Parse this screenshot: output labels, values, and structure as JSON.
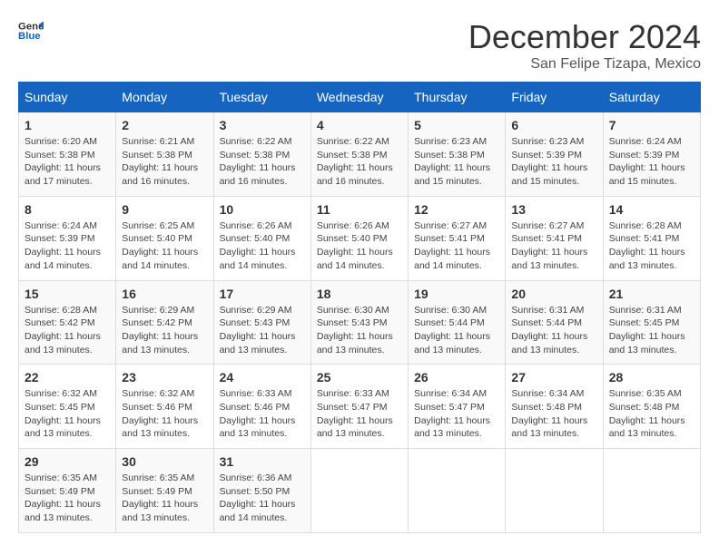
{
  "logo": {
    "general": "General",
    "blue": "Blue"
  },
  "header": {
    "title": "December 2024",
    "location": "San Felipe Tizapa, Mexico"
  },
  "weekdays": [
    "Sunday",
    "Monday",
    "Tuesday",
    "Wednesday",
    "Thursday",
    "Friday",
    "Saturday"
  ],
  "weeks": [
    [
      {
        "day": "1",
        "sunrise": "Sunrise: 6:20 AM",
        "sunset": "Sunset: 5:38 PM",
        "daylight": "Daylight: 11 hours and 17 minutes."
      },
      {
        "day": "2",
        "sunrise": "Sunrise: 6:21 AM",
        "sunset": "Sunset: 5:38 PM",
        "daylight": "Daylight: 11 hours and 16 minutes."
      },
      {
        "day": "3",
        "sunrise": "Sunrise: 6:22 AM",
        "sunset": "Sunset: 5:38 PM",
        "daylight": "Daylight: 11 hours and 16 minutes."
      },
      {
        "day": "4",
        "sunrise": "Sunrise: 6:22 AM",
        "sunset": "Sunset: 5:38 PM",
        "daylight": "Daylight: 11 hours and 16 minutes."
      },
      {
        "day": "5",
        "sunrise": "Sunrise: 6:23 AM",
        "sunset": "Sunset: 5:38 PM",
        "daylight": "Daylight: 11 hours and 15 minutes."
      },
      {
        "day": "6",
        "sunrise": "Sunrise: 6:23 AM",
        "sunset": "Sunset: 5:39 PM",
        "daylight": "Daylight: 11 hours and 15 minutes."
      },
      {
        "day": "7",
        "sunrise": "Sunrise: 6:24 AM",
        "sunset": "Sunset: 5:39 PM",
        "daylight": "Daylight: 11 hours and 15 minutes."
      }
    ],
    [
      {
        "day": "8",
        "sunrise": "Sunrise: 6:24 AM",
        "sunset": "Sunset: 5:39 PM",
        "daylight": "Daylight: 11 hours and 14 minutes."
      },
      {
        "day": "9",
        "sunrise": "Sunrise: 6:25 AM",
        "sunset": "Sunset: 5:40 PM",
        "daylight": "Daylight: 11 hours and 14 minutes."
      },
      {
        "day": "10",
        "sunrise": "Sunrise: 6:26 AM",
        "sunset": "Sunset: 5:40 PM",
        "daylight": "Daylight: 11 hours and 14 minutes."
      },
      {
        "day": "11",
        "sunrise": "Sunrise: 6:26 AM",
        "sunset": "Sunset: 5:40 PM",
        "daylight": "Daylight: 11 hours and 14 minutes."
      },
      {
        "day": "12",
        "sunrise": "Sunrise: 6:27 AM",
        "sunset": "Sunset: 5:41 PM",
        "daylight": "Daylight: 11 hours and 14 minutes."
      },
      {
        "day": "13",
        "sunrise": "Sunrise: 6:27 AM",
        "sunset": "Sunset: 5:41 PM",
        "daylight": "Daylight: 11 hours and 13 minutes."
      },
      {
        "day": "14",
        "sunrise": "Sunrise: 6:28 AM",
        "sunset": "Sunset: 5:41 PM",
        "daylight": "Daylight: 11 hours and 13 minutes."
      }
    ],
    [
      {
        "day": "15",
        "sunrise": "Sunrise: 6:28 AM",
        "sunset": "Sunset: 5:42 PM",
        "daylight": "Daylight: 11 hours and 13 minutes."
      },
      {
        "day": "16",
        "sunrise": "Sunrise: 6:29 AM",
        "sunset": "Sunset: 5:42 PM",
        "daylight": "Daylight: 11 hours and 13 minutes."
      },
      {
        "day": "17",
        "sunrise": "Sunrise: 6:29 AM",
        "sunset": "Sunset: 5:43 PM",
        "daylight": "Daylight: 11 hours and 13 minutes."
      },
      {
        "day": "18",
        "sunrise": "Sunrise: 6:30 AM",
        "sunset": "Sunset: 5:43 PM",
        "daylight": "Daylight: 11 hours and 13 minutes."
      },
      {
        "day": "19",
        "sunrise": "Sunrise: 6:30 AM",
        "sunset": "Sunset: 5:44 PM",
        "daylight": "Daylight: 11 hours and 13 minutes."
      },
      {
        "day": "20",
        "sunrise": "Sunrise: 6:31 AM",
        "sunset": "Sunset: 5:44 PM",
        "daylight": "Daylight: 11 hours and 13 minutes."
      },
      {
        "day": "21",
        "sunrise": "Sunrise: 6:31 AM",
        "sunset": "Sunset: 5:45 PM",
        "daylight": "Daylight: 11 hours and 13 minutes."
      }
    ],
    [
      {
        "day": "22",
        "sunrise": "Sunrise: 6:32 AM",
        "sunset": "Sunset: 5:45 PM",
        "daylight": "Daylight: 11 hours and 13 minutes."
      },
      {
        "day": "23",
        "sunrise": "Sunrise: 6:32 AM",
        "sunset": "Sunset: 5:46 PM",
        "daylight": "Daylight: 11 hours and 13 minutes."
      },
      {
        "day": "24",
        "sunrise": "Sunrise: 6:33 AM",
        "sunset": "Sunset: 5:46 PM",
        "daylight": "Daylight: 11 hours and 13 minutes."
      },
      {
        "day": "25",
        "sunrise": "Sunrise: 6:33 AM",
        "sunset": "Sunset: 5:47 PM",
        "daylight": "Daylight: 11 hours and 13 minutes."
      },
      {
        "day": "26",
        "sunrise": "Sunrise: 6:34 AM",
        "sunset": "Sunset: 5:47 PM",
        "daylight": "Daylight: 11 hours and 13 minutes."
      },
      {
        "day": "27",
        "sunrise": "Sunrise: 6:34 AM",
        "sunset": "Sunset: 5:48 PM",
        "daylight": "Daylight: 11 hours and 13 minutes."
      },
      {
        "day": "28",
        "sunrise": "Sunrise: 6:35 AM",
        "sunset": "Sunset: 5:48 PM",
        "daylight": "Daylight: 11 hours and 13 minutes."
      }
    ],
    [
      {
        "day": "29",
        "sunrise": "Sunrise: 6:35 AM",
        "sunset": "Sunset: 5:49 PM",
        "daylight": "Daylight: 11 hours and 13 minutes."
      },
      {
        "day": "30",
        "sunrise": "Sunrise: 6:35 AM",
        "sunset": "Sunset: 5:49 PM",
        "daylight": "Daylight: 11 hours and 13 minutes."
      },
      {
        "day": "31",
        "sunrise": "Sunrise: 6:36 AM",
        "sunset": "Sunset: 5:50 PM",
        "daylight": "Daylight: 11 hours and 14 minutes."
      },
      null,
      null,
      null,
      null
    ]
  ]
}
